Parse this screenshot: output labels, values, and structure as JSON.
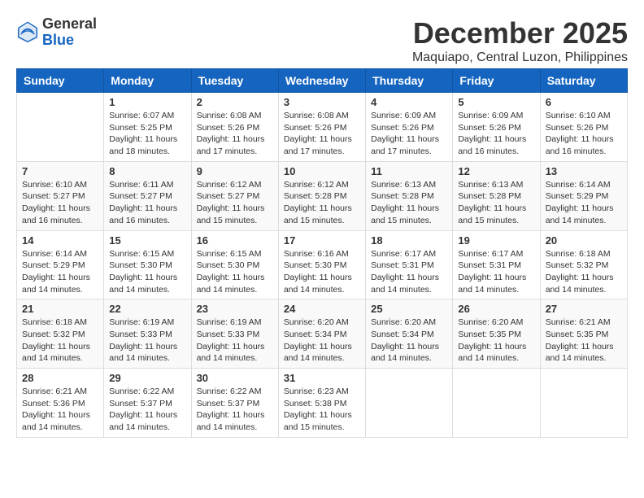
{
  "logo": {
    "general": "General",
    "blue": "Blue"
  },
  "title": {
    "month": "December 2025",
    "location": "Maquiapo, Central Luzon, Philippines"
  },
  "weekdays": [
    "Sunday",
    "Monday",
    "Tuesday",
    "Wednesday",
    "Thursday",
    "Friday",
    "Saturday"
  ],
  "weeks": [
    [
      {
        "day": "",
        "sunrise": "",
        "sunset": "",
        "daylight": ""
      },
      {
        "day": "1",
        "sunrise": "Sunrise: 6:07 AM",
        "sunset": "Sunset: 5:25 PM",
        "daylight": "Daylight: 11 hours and 18 minutes."
      },
      {
        "day": "2",
        "sunrise": "Sunrise: 6:08 AM",
        "sunset": "Sunset: 5:26 PM",
        "daylight": "Daylight: 11 hours and 17 minutes."
      },
      {
        "day": "3",
        "sunrise": "Sunrise: 6:08 AM",
        "sunset": "Sunset: 5:26 PM",
        "daylight": "Daylight: 11 hours and 17 minutes."
      },
      {
        "day": "4",
        "sunrise": "Sunrise: 6:09 AM",
        "sunset": "Sunset: 5:26 PM",
        "daylight": "Daylight: 11 hours and 17 minutes."
      },
      {
        "day": "5",
        "sunrise": "Sunrise: 6:09 AM",
        "sunset": "Sunset: 5:26 PM",
        "daylight": "Daylight: 11 hours and 16 minutes."
      },
      {
        "day": "6",
        "sunrise": "Sunrise: 6:10 AM",
        "sunset": "Sunset: 5:26 PM",
        "daylight": "Daylight: 11 hours and 16 minutes."
      }
    ],
    [
      {
        "day": "7",
        "sunrise": "Sunrise: 6:10 AM",
        "sunset": "Sunset: 5:27 PM",
        "daylight": "Daylight: 11 hours and 16 minutes."
      },
      {
        "day": "8",
        "sunrise": "Sunrise: 6:11 AM",
        "sunset": "Sunset: 5:27 PM",
        "daylight": "Daylight: 11 hours and 16 minutes."
      },
      {
        "day": "9",
        "sunrise": "Sunrise: 6:12 AM",
        "sunset": "Sunset: 5:27 PM",
        "daylight": "Daylight: 11 hours and 15 minutes."
      },
      {
        "day": "10",
        "sunrise": "Sunrise: 6:12 AM",
        "sunset": "Sunset: 5:28 PM",
        "daylight": "Daylight: 11 hours and 15 minutes."
      },
      {
        "day": "11",
        "sunrise": "Sunrise: 6:13 AM",
        "sunset": "Sunset: 5:28 PM",
        "daylight": "Daylight: 11 hours and 15 minutes."
      },
      {
        "day": "12",
        "sunrise": "Sunrise: 6:13 AM",
        "sunset": "Sunset: 5:28 PM",
        "daylight": "Daylight: 11 hours and 15 minutes."
      },
      {
        "day": "13",
        "sunrise": "Sunrise: 6:14 AM",
        "sunset": "Sunset: 5:29 PM",
        "daylight": "Daylight: 11 hours and 14 minutes."
      }
    ],
    [
      {
        "day": "14",
        "sunrise": "Sunrise: 6:14 AM",
        "sunset": "Sunset: 5:29 PM",
        "daylight": "Daylight: 11 hours and 14 minutes."
      },
      {
        "day": "15",
        "sunrise": "Sunrise: 6:15 AM",
        "sunset": "Sunset: 5:30 PM",
        "daylight": "Daylight: 11 hours and 14 minutes."
      },
      {
        "day": "16",
        "sunrise": "Sunrise: 6:15 AM",
        "sunset": "Sunset: 5:30 PM",
        "daylight": "Daylight: 11 hours and 14 minutes."
      },
      {
        "day": "17",
        "sunrise": "Sunrise: 6:16 AM",
        "sunset": "Sunset: 5:30 PM",
        "daylight": "Daylight: 11 hours and 14 minutes."
      },
      {
        "day": "18",
        "sunrise": "Sunrise: 6:17 AM",
        "sunset": "Sunset: 5:31 PM",
        "daylight": "Daylight: 11 hours and 14 minutes."
      },
      {
        "day": "19",
        "sunrise": "Sunrise: 6:17 AM",
        "sunset": "Sunset: 5:31 PM",
        "daylight": "Daylight: 11 hours and 14 minutes."
      },
      {
        "day": "20",
        "sunrise": "Sunrise: 6:18 AM",
        "sunset": "Sunset: 5:32 PM",
        "daylight": "Daylight: 11 hours and 14 minutes."
      }
    ],
    [
      {
        "day": "21",
        "sunrise": "Sunrise: 6:18 AM",
        "sunset": "Sunset: 5:32 PM",
        "daylight": "Daylight: 11 hours and 14 minutes."
      },
      {
        "day": "22",
        "sunrise": "Sunrise: 6:19 AM",
        "sunset": "Sunset: 5:33 PM",
        "daylight": "Daylight: 11 hours and 14 minutes."
      },
      {
        "day": "23",
        "sunrise": "Sunrise: 6:19 AM",
        "sunset": "Sunset: 5:33 PM",
        "daylight": "Daylight: 11 hours and 14 minutes."
      },
      {
        "day": "24",
        "sunrise": "Sunrise: 6:20 AM",
        "sunset": "Sunset: 5:34 PM",
        "daylight": "Daylight: 11 hours and 14 minutes."
      },
      {
        "day": "25",
        "sunrise": "Sunrise: 6:20 AM",
        "sunset": "Sunset: 5:34 PM",
        "daylight": "Daylight: 11 hours and 14 minutes."
      },
      {
        "day": "26",
        "sunrise": "Sunrise: 6:20 AM",
        "sunset": "Sunset: 5:35 PM",
        "daylight": "Daylight: 11 hours and 14 minutes."
      },
      {
        "day": "27",
        "sunrise": "Sunrise: 6:21 AM",
        "sunset": "Sunset: 5:35 PM",
        "daylight": "Daylight: 11 hours and 14 minutes."
      }
    ],
    [
      {
        "day": "28",
        "sunrise": "Sunrise: 6:21 AM",
        "sunset": "Sunset: 5:36 PM",
        "daylight": "Daylight: 11 hours and 14 minutes."
      },
      {
        "day": "29",
        "sunrise": "Sunrise: 6:22 AM",
        "sunset": "Sunset: 5:37 PM",
        "daylight": "Daylight: 11 hours and 14 minutes."
      },
      {
        "day": "30",
        "sunrise": "Sunrise: 6:22 AM",
        "sunset": "Sunset: 5:37 PM",
        "daylight": "Daylight: 11 hours and 14 minutes."
      },
      {
        "day": "31",
        "sunrise": "Sunrise: 6:23 AM",
        "sunset": "Sunset: 5:38 PM",
        "daylight": "Daylight: 11 hours and 15 minutes."
      },
      {
        "day": "",
        "sunrise": "",
        "sunset": "",
        "daylight": ""
      },
      {
        "day": "",
        "sunrise": "",
        "sunset": "",
        "daylight": ""
      },
      {
        "day": "",
        "sunrise": "",
        "sunset": "",
        "daylight": ""
      }
    ]
  ]
}
